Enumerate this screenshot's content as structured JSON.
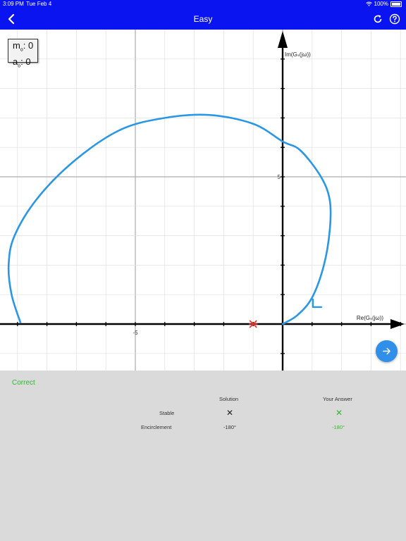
{
  "status_bar": {
    "time": "3:09 PM",
    "date": "Tue Feb 4",
    "battery": "100%"
  },
  "nav": {
    "title": "Easy",
    "back_icon": "chevron-left-icon",
    "refresh_icon": "refresh-icon",
    "help_icon": "help-icon"
  },
  "legend": {
    "m_label": "m",
    "m_sub": "o",
    "m_value": ": 0",
    "a_label": "a",
    "a_sub": "o",
    "a_value": ": 0"
  },
  "chart_data": {
    "type": "line",
    "title": "",
    "xlabel": "Re(Gₛ(jω))",
    "ylabel": "Im(Gₛ(jω))",
    "xlim": [
      -9.6,
      4.1
    ],
    "ylim": [
      -1.6,
      9.8
    ],
    "x_tick_labels": [
      "-5"
    ],
    "y_tick_labels": [
      "5"
    ],
    "grid": true,
    "critical_point": {
      "x": -1,
      "y": 0,
      "color": "#e8352b"
    },
    "series": [
      {
        "color": "#2a97e6",
        "x": [
          0,
          0.5,
          1.0,
          1.4,
          1.6,
          1.6,
          1.3,
          0.6,
          0,
          -1.0,
          -2.5,
          -4.0,
          -5.5,
          -7.0,
          -8.3,
          -9.1,
          -9.3,
          -9.2,
          -8.9
        ],
        "y": [
          0,
          0.3,
          0.9,
          2.0,
          3.2,
          4.2,
          5.0,
          5.9,
          6.2,
          6.8,
          7.1,
          7.0,
          6.6,
          5.6,
          4.3,
          3.0,
          2.0,
          1.0,
          0.05
        ]
      }
    ],
    "direction_arrow": {
      "x": 1.05,
      "y": 0.6
    }
  },
  "next_icon": "arrow-right-icon",
  "feedback": {
    "status": "Correct",
    "status_color": "#33b533",
    "headers": {
      "solution": "Solution",
      "your_answer": "Your Answer"
    },
    "rows": [
      {
        "label": "Stable",
        "solution": "✕",
        "answer": "✕"
      },
      {
        "label": "Encirclement",
        "solution": "-180°",
        "answer": "-180°"
      }
    ]
  }
}
